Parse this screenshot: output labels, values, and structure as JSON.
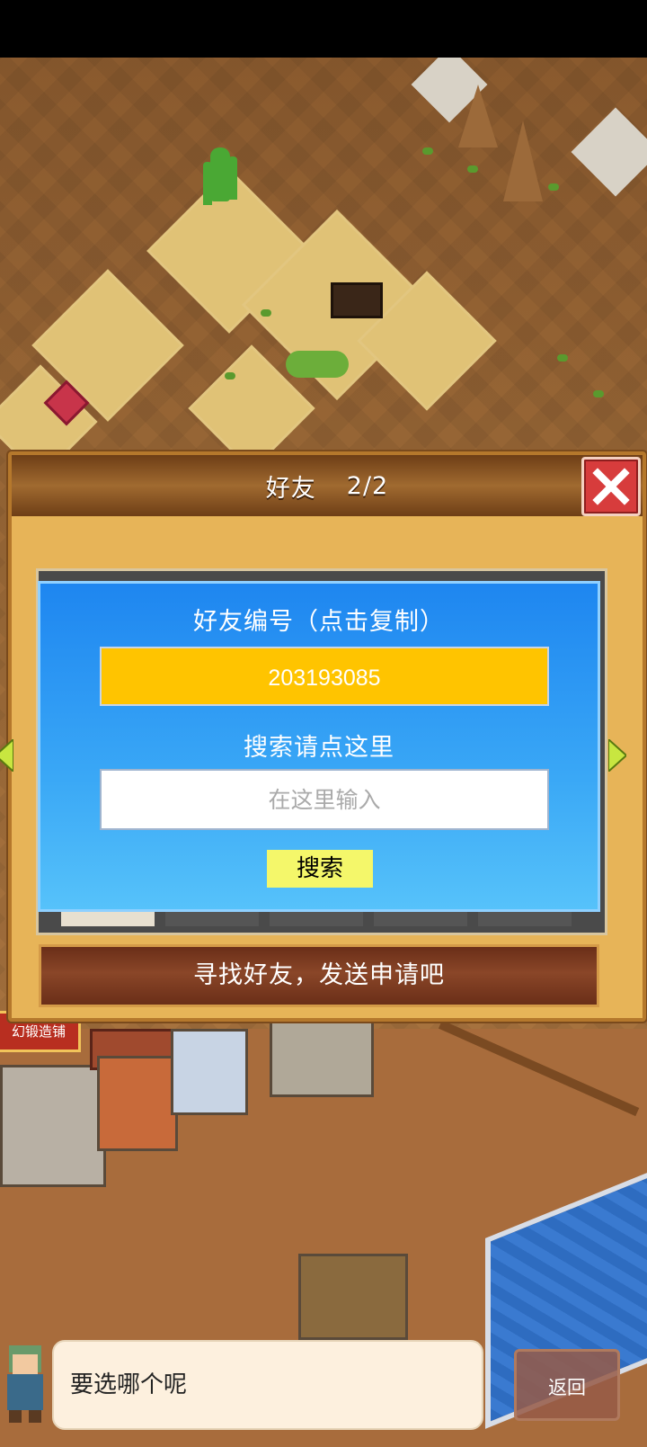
{
  "dialog": {
    "title": "好友",
    "count": "2/2",
    "friend_id_label": "好友编号（点击复制）",
    "friend_id": "203193085",
    "search_hint": "搜索请点这里",
    "search_placeholder": "在这里输入",
    "search_button": "搜索",
    "find_friend_button": "寻找好友，发送申请吧"
  },
  "map": {
    "shop_sign": "幻锻造铺"
  },
  "bottom": {
    "speech_text": "要选哪个呢",
    "back_button": "返回"
  },
  "colors": {
    "dialog_bg": "#e7b458",
    "header_brown": "#6e3e16",
    "close_red": "#d73c3c",
    "panel_blue": "#1e86f0",
    "id_yellow": "#ffc400",
    "search_btn_yellow": "#f4f76a",
    "find_bar_brown": "#6a2e18"
  },
  "icons": {
    "close": "close-x-icon",
    "left_arrow": "arrow-left-icon",
    "right_arrow": "arrow-right-icon"
  }
}
